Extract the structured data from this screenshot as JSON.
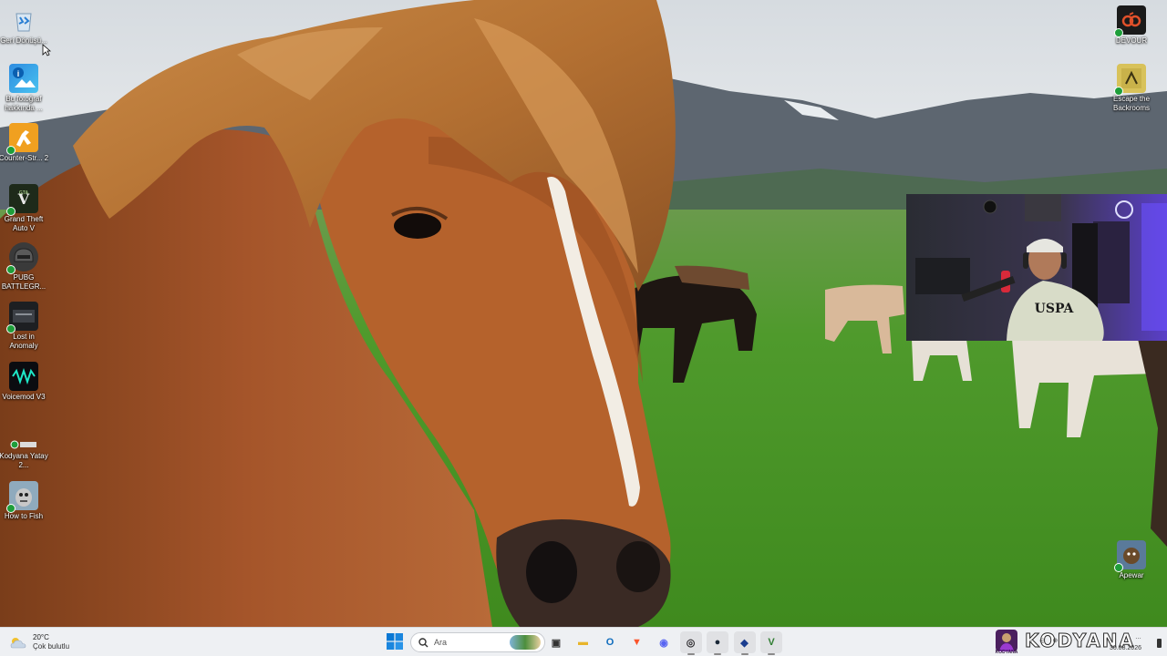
{
  "desktop": {
    "left_icons": [
      {
        "name": "recycle-bin-icon",
        "label": "Geri Dönüşü..."
      },
      {
        "name": "info-photo-icon",
        "label": "Bu fotoğraf hakkında ..."
      },
      {
        "name": "counter-strike-icon",
        "label": "Counter-Str... 2"
      },
      {
        "name": "gta-icon",
        "label": "Grand Theft Auto V"
      },
      {
        "name": "pubg-icon",
        "label": "PUBG BATTLEGR..."
      },
      {
        "name": "lost-in-anomaly-icon",
        "label": "Lost in Anomaly"
      },
      {
        "name": "voicemod-icon",
        "label": "Voicemod V3"
      },
      {
        "name": "kodyana-file-icon",
        "label": "Kodyana Yatay 2..."
      },
      {
        "name": "how-to-fish-icon",
        "label": "How to Fish"
      }
    ],
    "right_icons": [
      {
        "name": "devour-icon",
        "label": "DEVOUR"
      },
      {
        "name": "escape-backrooms-icon",
        "label": "Escape the Backrooms"
      },
      {
        "name": "apewar-icon",
        "label": "Apewar"
      }
    ]
  },
  "taskbar": {
    "weather": {
      "temp": "20°C",
      "condition": "Çok bulutlu"
    },
    "search_placeholder": "Ara",
    "apps": [
      {
        "name": "task-view-icon",
        "glyph": "▣",
        "color": "#333333"
      },
      {
        "name": "file-explorer-icon",
        "glyph": "▬",
        "color": "#e8b52a"
      },
      {
        "name": "outlook-icon",
        "glyph": "O",
        "color": "#0f6cbd"
      },
      {
        "name": "brave-icon",
        "glyph": "▼",
        "color": "#fb542b"
      },
      {
        "name": "discord-icon",
        "glyph": "◉",
        "color": "#5865f2"
      },
      {
        "name": "obs-icon",
        "glyph": "◎",
        "color": "#302e31"
      },
      {
        "name": "steam-icon",
        "glyph": "●",
        "color": "#1b2838"
      },
      {
        "name": "streaming-app-icon",
        "glyph": "◆",
        "color": "#1a3d8f"
      },
      {
        "name": "vegas-icon",
        "glyph": "V",
        "color": "#2f7d32"
      }
    ],
    "brand": "KODYANA",
    "avatar_label": "KODYANA",
    "tray_glyphs": "‹ ◎ ⊕",
    "clock": {
      "time": "…",
      "date": "30.08.2026"
    }
  },
  "colors": {
    "taskbar_bg": "#eef0f3",
    "accent": "#0078d4"
  }
}
